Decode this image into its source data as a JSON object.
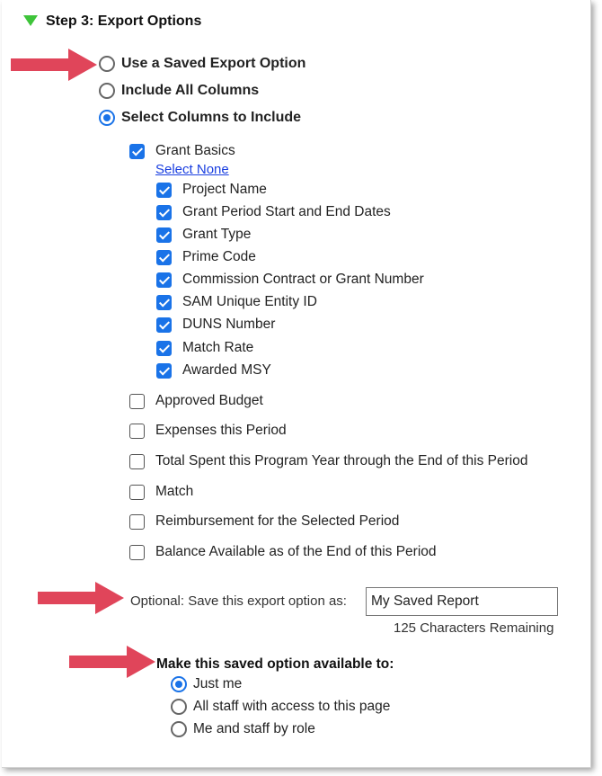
{
  "step": {
    "title": "Step 3: Export Options"
  },
  "export_mode": {
    "options": [
      {
        "label": "Use a Saved Export Option",
        "selected": false
      },
      {
        "label": "Include All Columns",
        "selected": false
      },
      {
        "label": "Select Columns to Include",
        "selected": true
      }
    ]
  },
  "grant_basics": {
    "label": "Grant Basics",
    "checked": true,
    "select_none_link": "Select None",
    "columns": [
      {
        "label": "Project Name",
        "checked": true
      },
      {
        "label": "Grant Period Start and End Dates",
        "checked": true
      },
      {
        "label": "Grant Type",
        "checked": true
      },
      {
        "label": "Prime Code",
        "checked": true
      },
      {
        "label": "Commission Contract or Grant Number",
        "checked": true
      },
      {
        "label": "SAM Unique Entity ID",
        "checked": true
      },
      {
        "label": "DUNS Number",
        "checked": true
      },
      {
        "label": "Match Rate",
        "checked": true
      },
      {
        "label": "Awarded MSY",
        "checked": true
      }
    ]
  },
  "other_groups": [
    {
      "label": "Approved Budget",
      "checked": false
    },
    {
      "label": "Expenses this Period",
      "checked": false
    },
    {
      "label": "Total Spent this Program Year through the End of this Period",
      "checked": false
    },
    {
      "label": "Match",
      "checked": false
    },
    {
      "label": "Reimbursement for the Selected Period",
      "checked": false
    },
    {
      "label": "Balance Available as of the End of this Period",
      "checked": false
    }
  ],
  "save_option": {
    "label": "Optional: Save this export option as:",
    "value": "My Saved Report",
    "remaining": "125 Characters Remaining"
  },
  "availability": {
    "label": "Make this saved option available to:",
    "options": [
      {
        "label": "Just me",
        "selected": true
      },
      {
        "label": "All staff with access to this page",
        "selected": false
      },
      {
        "label": "Me and staff by role",
        "selected": false
      }
    ]
  },
  "colors": {
    "accent": "#1a73e8",
    "annotation_arrow": "#e0455a",
    "toggle_triangle": "#3ec43a",
    "link": "#1a3fe0"
  },
  "icons": {
    "collapse_toggle": "triangle-down-icon",
    "annotation": "arrow-right-icon"
  }
}
